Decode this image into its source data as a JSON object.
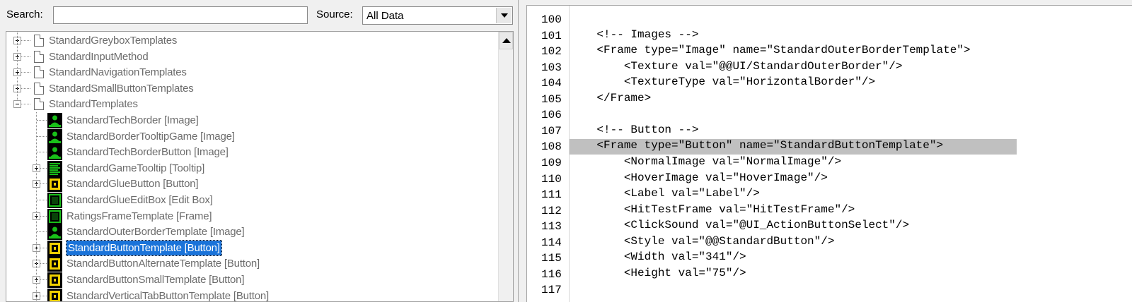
{
  "search": {
    "label": "Search:",
    "value": ""
  },
  "source": {
    "label": "Source:",
    "selected": "All Data"
  },
  "tree": {
    "items": [
      {
        "label": "StandardGreyboxTemplates",
        "level": 0,
        "expander": "plus",
        "icon": "document-icon"
      },
      {
        "label": "StandardInputMethod",
        "level": 0,
        "expander": "plus",
        "icon": "document-icon"
      },
      {
        "label": "StandardNavigationTemplates",
        "level": 0,
        "expander": "plus",
        "icon": "document-icon"
      },
      {
        "label": "StandardSmallButtonTemplates",
        "level": 0,
        "expander": "plus",
        "icon": "document-icon"
      },
      {
        "label": "StandardTemplates",
        "level": 0,
        "expander": "minus",
        "icon": "document-icon"
      },
      {
        "label": "StandardTechBorder [Image]",
        "level": 1,
        "expander": "none",
        "icon": "image-icon"
      },
      {
        "label": "StandardBorderTooltipGame [Image]",
        "level": 1,
        "expander": "none",
        "icon": "image-icon"
      },
      {
        "label": "StandardTechBorderButton [Image]",
        "level": 1,
        "expander": "none",
        "icon": "image-icon"
      },
      {
        "label": "StandardGameTooltip [Tooltip]",
        "level": 1,
        "expander": "plus",
        "icon": "tooltip-icon"
      },
      {
        "label": "StandardGlueButton [Button]",
        "level": 1,
        "expander": "plus",
        "icon": "button-icon"
      },
      {
        "label": "StandardGlueEditBox [Edit Box]",
        "level": 1,
        "expander": "none",
        "icon": "editbox-icon"
      },
      {
        "label": "RatingsFrameTemplate [Frame]",
        "level": 1,
        "expander": "plus",
        "icon": "frame-icon"
      },
      {
        "label": "StandardOuterBorderTemplate [Image]",
        "level": 1,
        "expander": "none",
        "icon": "image-icon"
      },
      {
        "label": "StandardButtonTemplate [Button]",
        "level": 1,
        "expander": "plus",
        "icon": "button-icon",
        "selected": true
      },
      {
        "label": "StandardButtonAlternateTemplate [Button]",
        "level": 1,
        "expander": "plus",
        "icon": "button-icon"
      },
      {
        "label": "StandardButtonSmallTemplate [Button]",
        "level": 1,
        "expander": "plus",
        "icon": "button-icon"
      },
      {
        "label": "StandardVerticalTabButtonTemplate [Button]",
        "level": 1,
        "expander": "plus",
        "icon": "button-icon"
      }
    ]
  },
  "editor": {
    "lines": [
      {
        "n": "100",
        "text": ""
      },
      {
        "n": "101",
        "text": "    <!-- Images -->"
      },
      {
        "n": "102",
        "text": "    <Frame type=\"Image\" name=\"StandardOuterBorderTemplate\">"
      },
      {
        "n": "103",
        "text": "        <Texture val=\"@@UI/StandardOuterBorder\"/>"
      },
      {
        "n": "104",
        "text": "        <TextureType val=\"HorizontalBorder\"/>"
      },
      {
        "n": "105",
        "text": "    </Frame>"
      },
      {
        "n": "106",
        "text": ""
      },
      {
        "n": "107",
        "text": "    <!-- Button -->"
      },
      {
        "n": "108",
        "text": "    <Frame type=\"Button\" name=\"StandardButtonTemplate\">",
        "highlight": true
      },
      {
        "n": "109",
        "text": "        <NormalImage val=\"NormalImage\"/>"
      },
      {
        "n": "110",
        "text": "        <HoverImage val=\"HoverImage\"/>"
      },
      {
        "n": "111",
        "text": "        <Label val=\"Label\"/>"
      },
      {
        "n": "112",
        "text": "        <HitTestFrame val=\"HitTestFrame\"/>"
      },
      {
        "n": "113",
        "text": "        <ClickSound val=\"@UI_ActionButtonSelect\"/>"
      },
      {
        "n": "114",
        "text": "        <Style val=\"@@StandardButton\"/>"
      },
      {
        "n": "115",
        "text": "        <Width val=\"341\"/>"
      },
      {
        "n": "116",
        "text": "        <Height val=\"75\"/>"
      },
      {
        "n": "117",
        "text": ""
      }
    ]
  },
  "colors": {
    "selection": "#1a73d9",
    "line_highlight": "#c0c0c0",
    "icon_green": "#19c019",
    "icon_yellow": "#f0d000"
  }
}
